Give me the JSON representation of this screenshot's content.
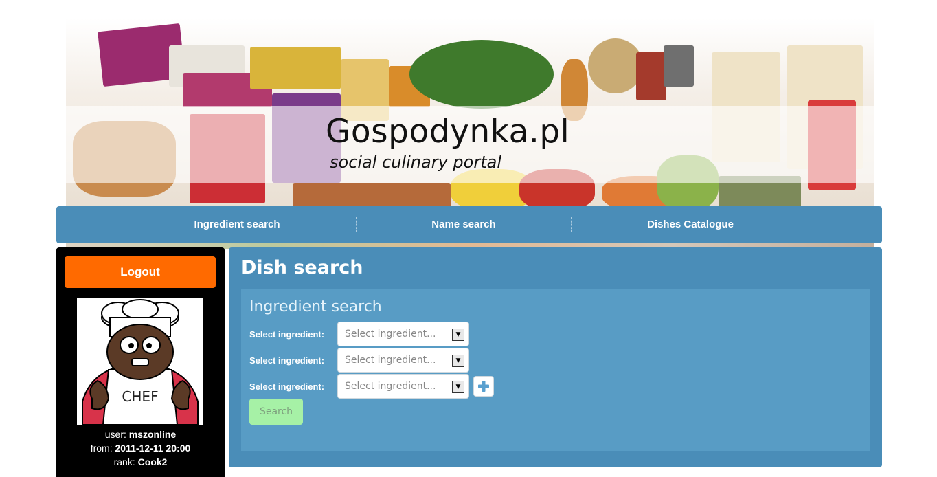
{
  "banner": {
    "title": "Gospodynka.pl",
    "subtitle": "social culinary portal"
  },
  "nav": {
    "items": [
      {
        "label": "Ingredient search"
      },
      {
        "label": "Name search"
      },
      {
        "label": "Dishes Catalogue"
      }
    ]
  },
  "sidebar": {
    "logout_label": "Logout",
    "avatar_text": "CHEF",
    "user_label": "user:",
    "user_value": "mszonline",
    "from_label": "from:",
    "from_value": "2011-12-11 20:00",
    "rank_label": "rank:",
    "rank_value": "Cook2"
  },
  "main": {
    "title": "Dish search",
    "section_title": "Ingredient search",
    "rows": [
      {
        "label": "Select ingredient:",
        "placeholder": "Select ingredient..."
      },
      {
        "label": "Select ingredient:",
        "placeholder": "Select ingredient..."
      },
      {
        "label": "Select ingredient:",
        "placeholder": "Select ingredient..."
      }
    ],
    "search_label": "Search"
  },
  "colors": {
    "nav_bg": "#4a8db8",
    "inner_bg": "#589cc5",
    "logout_bg": "#ff6a00",
    "search_bg": "#a6f1a6"
  },
  "icons": [
    "plus-icon",
    "dropdown-arrow-icon"
  ]
}
